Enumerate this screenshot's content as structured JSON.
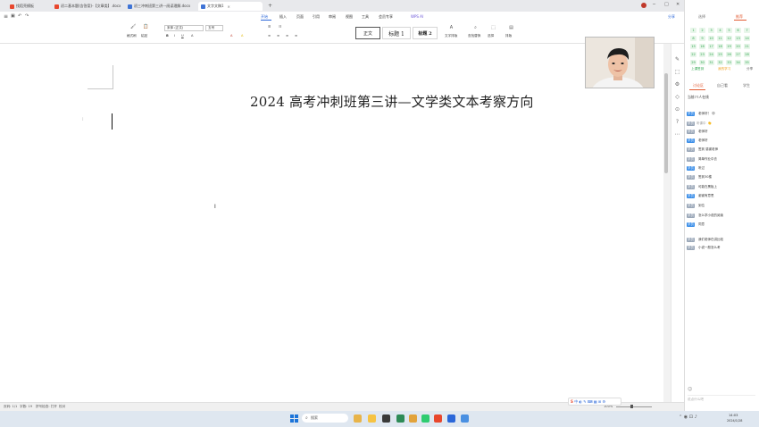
{
  "window": {
    "tabs": [
      {
        "label": "找稻壳模板",
        "icon_color": "#e8472d",
        "active": false
      },
      {
        "label": "初二基本题(含答案)-【文章类】.docx",
        "icon_color": "#e8472d",
        "active": false
      },
      {
        "label": "初三冲刺班第三讲---阅读理解.docx",
        "icon_color": "#3f74d6",
        "active": false
      },
      {
        "label": "文字文稿1",
        "icon_color": "#3f74d6",
        "active": true
      }
    ],
    "new_tab": "+",
    "controls": [
      "─",
      "□",
      "✕"
    ]
  },
  "menu": {
    "items": [
      "开始",
      "插入",
      "页面",
      "引用",
      "审阅",
      "视图",
      "工具",
      "会员专享"
    ],
    "active_index": 0,
    "ai_label": "WPS AI",
    "share_label": "分享"
  },
  "ribbon": {
    "paste_label": "格式刷",
    "clipboard_label": "粘贴",
    "font_name": "宋体 (正文)",
    "font_size": "五号",
    "styles": [
      "正文",
      "标题 1",
      "标题 2"
    ],
    "text_tools": "文字排版",
    "find_replace": "查找替换",
    "select": "选择",
    "layout": "排版"
  },
  "document": {
    "title": "2024 高考冲刺班第三讲—文学类文本考察方向"
  },
  "status": {
    "page": "页码: 1/1",
    "words": "字数: 19",
    "spell": "拼写检查: 打开",
    "check": "校对",
    "zoom": "100%"
  },
  "taskbar": {
    "search_placeholder": "搜索",
    "time": "14:03",
    "date": "2024/1/28"
  },
  "right_panel": {
    "top_tabs": [
      "选择",
      "推荐"
    ],
    "answer_grid": [
      [
        "1",
        "2",
        "3",
        "4",
        "5",
        "6",
        "7"
      ],
      [
        "8",
        "9",
        "10",
        "11",
        "12",
        "13",
        "14"
      ],
      [
        "15",
        "16",
        "17",
        "18",
        "19",
        "20",
        "21"
      ],
      [
        "22",
        "23",
        "24",
        "25",
        "26",
        "27",
        "28"
      ],
      [
        "29",
        "30",
        "31",
        "32",
        "33",
        "34",
        "35"
      ]
    ],
    "grid_actions": [
      "上课签到",
      "我的学习",
      "分享"
    ],
    "tabs": [
      "讨论区",
      "自己看",
      "学生"
    ],
    "online": "当前77人在线",
    "messages": [
      {
        "tag": "学员",
        "name": "",
        "text": "老师好！ 😊"
      },
      {
        "tag": "学员",
        "name": "听课中",
        "text": "👏"
      },
      {
        "tag": "学员",
        "name": "",
        "text": "老师好"
      },
      {
        "tag": "学员",
        "name": "",
        "text": "老师好"
      },
      {
        "tag": "学员",
        "name": "",
        "text": "签到 感谢老师"
      },
      {
        "tag": "学员",
        "name": "",
        "text": "简单作业中去"
      },
      {
        "tag": "学员",
        "name": "",
        "text": "听过"
      },
      {
        "tag": "学员",
        "name": "",
        "text": "签到30楼"
      },
      {
        "tag": "学员",
        "name": "",
        "text": "可能在黑板上"
      },
      {
        "tag": "学员",
        "name": "",
        "text": "谢谢有意思"
      },
      {
        "tag": "学员",
        "name": "",
        "text": "到位"
      },
      {
        "tag": "学员",
        "name": "",
        "text": "怎么学小说的阅读"
      },
      {
        "tag": "学员",
        "name": "",
        "text": "同意"
      },
      {
        "tag": "学员",
        "name": "",
        "text": "我们老师在讲比较"
      },
      {
        "tag": "学员",
        "name": "",
        "text": "小说一般怎么考"
      }
    ],
    "input_placeholder": "说点什么吧"
  }
}
